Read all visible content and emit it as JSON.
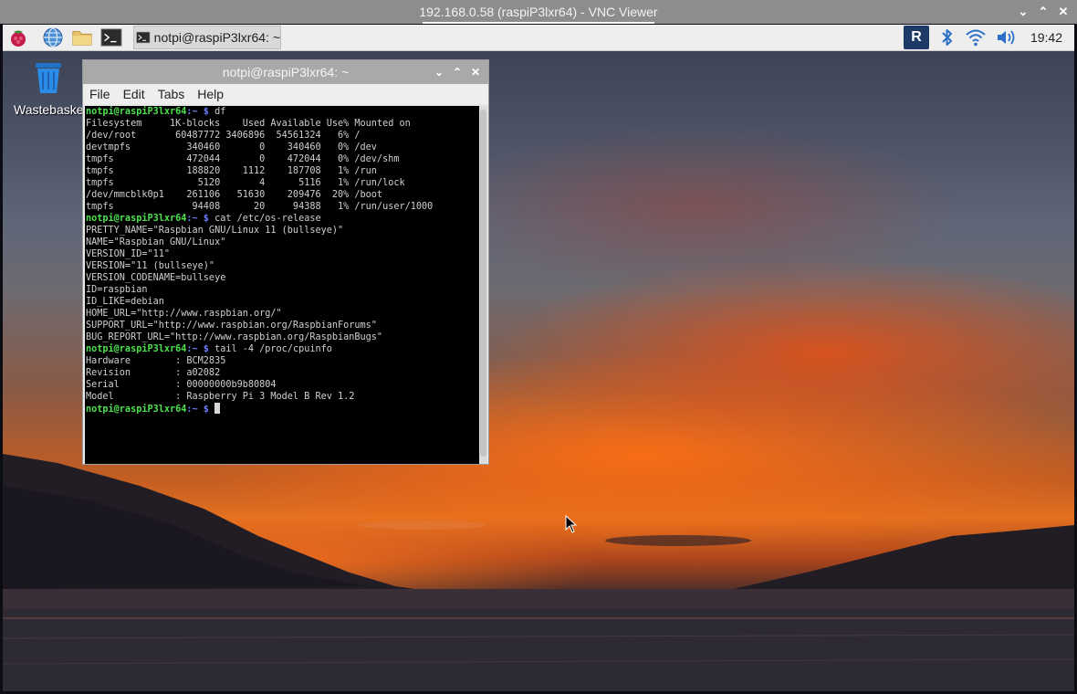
{
  "vnc": {
    "title": "192.168.0.58 (raspiP3lxr64) - VNC Viewer",
    "controls": [
      "⌄",
      "⌃",
      "✕"
    ]
  },
  "taskbar": {
    "task_label": "notpi@raspiP3lxr64: ~",
    "clock": "19:42",
    "vnc_tray_glyph": "R"
  },
  "desktop": {
    "wastebasket_label": "Wastebasket"
  },
  "terminal": {
    "title": "notpi@raspiP3lxr64: ~",
    "controls": [
      "⌄",
      "⌃",
      "✕"
    ],
    "menu": [
      "File",
      "Edit",
      "Tabs",
      "Help"
    ],
    "prompt_user": "notpi@raspiP3lxr64",
    "prompt_path": ":~ $",
    "lines": [
      {
        "type": "prompt",
        "cmd": " df"
      },
      {
        "type": "out",
        "text": "Filesystem     1K-blocks    Used Available Use% Mounted on"
      },
      {
        "type": "out",
        "text": "/dev/root       60487772 3406896  54561324   6% /"
      },
      {
        "type": "out",
        "text": "devtmpfs          340460       0    340460   0% /dev"
      },
      {
        "type": "out",
        "text": "tmpfs             472044       0    472044   0% /dev/shm"
      },
      {
        "type": "out",
        "text": "tmpfs             188820    1112    187708   1% /run"
      },
      {
        "type": "out",
        "text": "tmpfs               5120       4      5116   1% /run/lock"
      },
      {
        "type": "out",
        "text": "/dev/mmcblk0p1    261106   51630    209476  20% /boot"
      },
      {
        "type": "out",
        "text": "tmpfs              94408      20     94388   1% /run/user/1000"
      },
      {
        "type": "prompt",
        "cmd": " cat /etc/os-release"
      },
      {
        "type": "out",
        "text": "PRETTY_NAME=\"Raspbian GNU/Linux 11 (bullseye)\""
      },
      {
        "type": "out",
        "text": "NAME=\"Raspbian GNU/Linux\""
      },
      {
        "type": "out",
        "text": "VERSION_ID=\"11\""
      },
      {
        "type": "out",
        "text": "VERSION=\"11 (bullseye)\""
      },
      {
        "type": "out",
        "text": "VERSION_CODENAME=bullseye"
      },
      {
        "type": "out",
        "text": "ID=raspbian"
      },
      {
        "type": "out",
        "text": "ID_LIKE=debian"
      },
      {
        "type": "out",
        "text": "HOME_URL=\"http://www.raspbian.org/\""
      },
      {
        "type": "out",
        "text": "SUPPORT_URL=\"http://www.raspbian.org/RaspbianForums\""
      },
      {
        "type": "out",
        "text": "BUG_REPORT_URL=\"http://www.raspbian.org/RaspbianBugs\""
      },
      {
        "type": "prompt",
        "cmd": " tail -4 /proc/cpuinfo"
      },
      {
        "type": "out",
        "text": "Hardware        : BCM2835"
      },
      {
        "type": "out",
        "text": "Revision        : a02082"
      },
      {
        "type": "out",
        "text": "Serial          : 00000000b9b80804"
      },
      {
        "type": "out",
        "text": "Model           : Raspberry Pi 3 Model B Rev 1.2"
      },
      {
        "type": "prompt",
        "cmd": " ",
        "cursor": true
      }
    ]
  },
  "icons": {
    "taskbar": [
      "raspberry-menu-icon",
      "web-browser-icon",
      "file-manager-icon",
      "terminal-icon"
    ],
    "tray": [
      "vnc-server-icon",
      "bluetooth-icon",
      "wifi-icon",
      "volume-icon"
    ]
  },
  "colors": {
    "prompt_user": "#4ee24e",
    "prompt_path": "#6c7dff",
    "terminal_bg": "#000000",
    "taskbar_bg": "#eeeeee"
  }
}
